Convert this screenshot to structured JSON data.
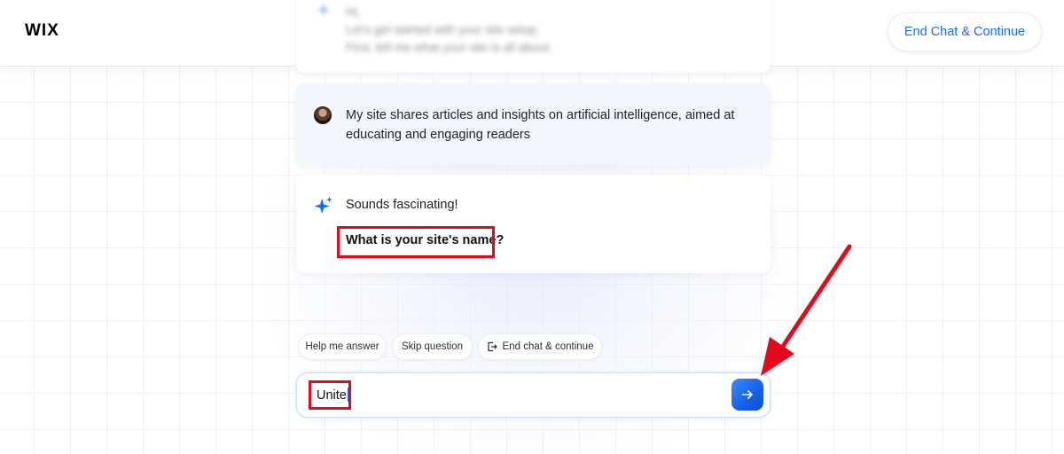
{
  "header": {
    "logo": "WIX",
    "end_chat_button": "End Chat & Continue"
  },
  "previous_message": {
    "lines": [
      "Hi,",
      "Let's get started with your site setup.",
      "First, tell me what your site is all about."
    ]
  },
  "user_message": {
    "text": "My site shares articles and insights on artificial intelligence, aimed at educating and engaging readers"
  },
  "bot_message": {
    "line1": "Sounds fascinating!",
    "question": "What is your site's name?"
  },
  "suggestions": {
    "help_me_answer": "Help me answer",
    "skip_question": "Skip question",
    "end_chat_continue": "End chat & continue"
  },
  "chat_input": {
    "value": "Unite"
  },
  "colors": {
    "brand_blue": "#116dff",
    "annotation_red": "#e4081d"
  },
  "icons": {
    "sparkle": "sparkle-icon",
    "send": "arrow-right-icon",
    "exit": "exit-icon"
  }
}
